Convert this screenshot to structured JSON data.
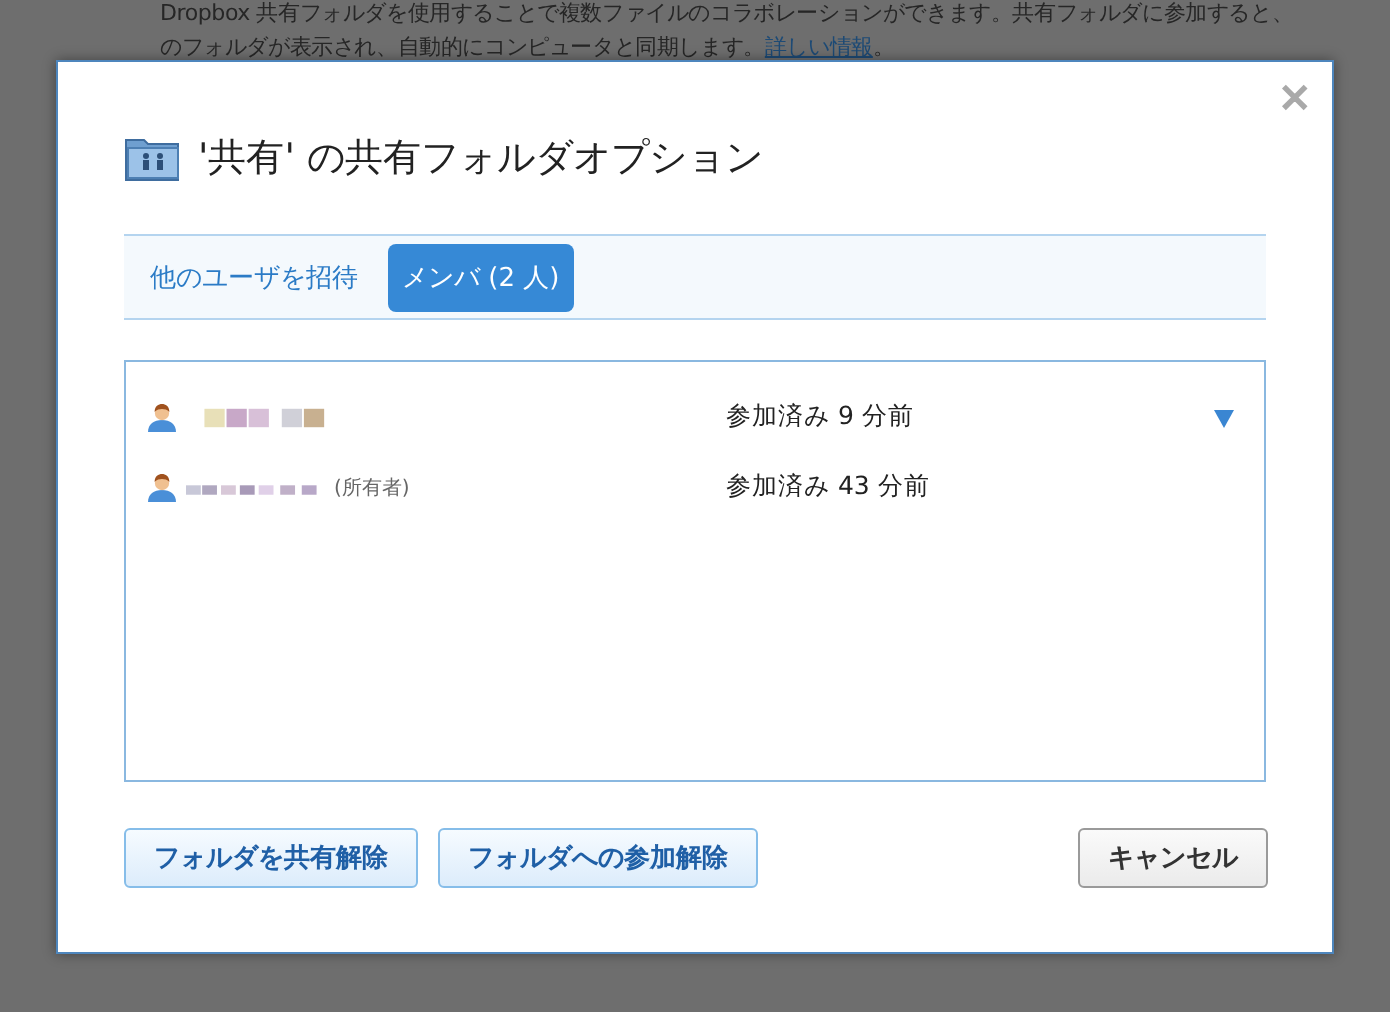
{
  "background_page": {
    "lines": [
      "Dropbox 共有フォルダを使用することで複数ファイルのコラボレーションができます。共有フォルダに参加すると、"
    ],
    "line_2": {
      "text": "のフォルダが表示され、自動的にコンピュータと同期します。",
      "link": "詳しい情報",
      "after": "。"
    }
  },
  "dialog": {
    "title": "'共有' の共有フォルダオプション",
    "close": "✕",
    "tabs": [
      {
        "label": "他のユーザを招待",
        "selected": false
      },
      {
        "label": "メンバ (2 人)",
        "selected": true
      }
    ],
    "members": [
      {
        "status": "参加済み 9 分前",
        "menu": true
      },
      {
        "owner_label": "(所有者)",
        "status": "参加済み 43 分前",
        "menu": false
      }
    ],
    "buttons": [
      {
        "label": "フォルダを共有解除",
        "kind": "primary"
      },
      {
        "label": "フォルダへの参加解除",
        "kind": "primary"
      },
      {
        "label": "キャンセル",
        "kind": "secondary"
      }
    ]
  }
}
